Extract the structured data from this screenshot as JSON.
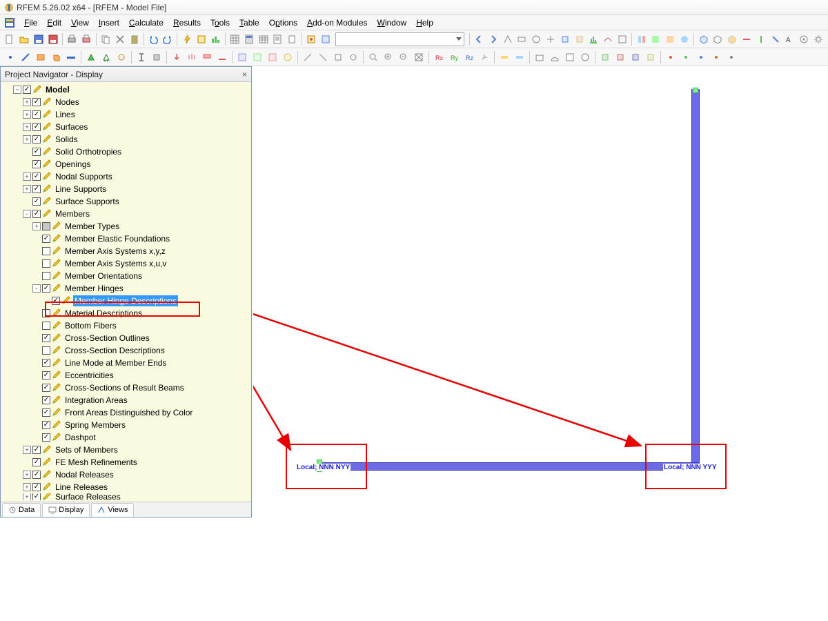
{
  "window": {
    "title": "RFEM 5.26.02 x64 - [RFEM - Model File]"
  },
  "menu": {
    "items": [
      "File",
      "Edit",
      "View",
      "Insert",
      "Calculate",
      "Results",
      "Tools",
      "Table",
      "Options",
      "Add-on Modules",
      "Window",
      "Help"
    ]
  },
  "navigator": {
    "title": "Project Navigator - Display",
    "tabs": {
      "data": "Data",
      "display": "Display",
      "views": "Views",
      "active": "display"
    }
  },
  "tree": {
    "root": "Model",
    "l1": [
      {
        "t": "Nodes",
        "c": true,
        "tw": "+"
      },
      {
        "t": "Lines",
        "c": true,
        "tw": "+"
      },
      {
        "t": "Surfaces",
        "c": true,
        "tw": "+"
      },
      {
        "t": "Solids",
        "c": true,
        "tw": "+"
      },
      {
        "t": "Solid Orthotropies",
        "c": true,
        "tw": ""
      },
      {
        "t": "Openings",
        "c": true,
        "tw": ""
      },
      {
        "t": "Nodal Supports",
        "c": true,
        "tw": "+"
      },
      {
        "t": "Line Supports",
        "c": true,
        "tw": "+"
      },
      {
        "t": "Surface Supports",
        "c": true,
        "tw": ""
      },
      {
        "t": "Members",
        "c": true,
        "tw": "-",
        "children": [
          {
            "t": "Member Types",
            "c": false,
            "gray": true,
            "tw": "+"
          },
          {
            "t": "Member Elastic Foundations",
            "c": true,
            "tw": ""
          },
          {
            "t": "Member Axis Systems x,y,z",
            "c": false,
            "tw": ""
          },
          {
            "t": "Member Axis Systems x,u,v",
            "c": false,
            "tw": ""
          },
          {
            "t": "Member Orientations",
            "c": false,
            "tw": ""
          },
          {
            "t": "Member Hinges",
            "c": true,
            "tw": "-",
            "children": [
              {
                "t": "Member Hinge Descriptions",
                "c": true,
                "sel": true
              }
            ]
          },
          {
            "t": "Material Descriptions",
            "c": false,
            "tw": ""
          },
          {
            "t": "Bottom Fibers",
            "c": false,
            "tw": ""
          },
          {
            "t": "Cross-Section Outlines",
            "c": true,
            "tw": ""
          },
          {
            "t": "Cross-Section Descriptions",
            "c": false,
            "tw": ""
          },
          {
            "t": "Line Mode at Member Ends",
            "c": true,
            "tw": ""
          },
          {
            "t": "Eccentricities",
            "c": true,
            "tw": ""
          },
          {
            "t": "Cross-Sections of Result Beams",
            "c": true,
            "tw": ""
          },
          {
            "t": "Integration Areas",
            "c": true,
            "tw": ""
          },
          {
            "t": "Front Areas Distinguished by Color",
            "c": true,
            "tw": ""
          },
          {
            "t": "Spring Members",
            "c": true,
            "tw": ""
          },
          {
            "t": "Dashpot",
            "c": true,
            "tw": ""
          }
        ]
      },
      {
        "t": "Sets of Members",
        "c": true,
        "tw": "+"
      },
      {
        "t": "FE Mesh Refinements",
        "c": true,
        "tw": ""
      },
      {
        "t": "Nodal Releases",
        "c": true,
        "tw": "+"
      },
      {
        "t": "Line Releases",
        "c": true,
        "tw": "+"
      },
      {
        "t": "Surface Releases",
        "c": true,
        "tw": "+",
        "cut": true
      }
    ]
  },
  "viewport": {
    "hinge_left": "Local; NNN NYY",
    "hinge_right": "Local; NNN YYY"
  }
}
